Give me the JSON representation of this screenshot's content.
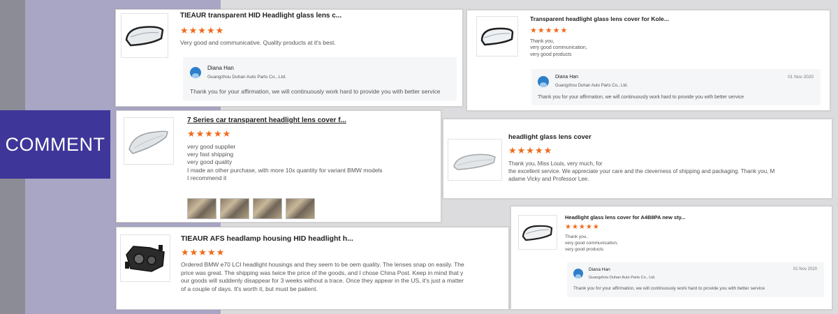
{
  "banner": {
    "label": "COMMENT"
  },
  "colors": {
    "accent_purple": "#3e3699",
    "star_orange": "#f06a1a",
    "avatar_blue": "#2d7fc9"
  },
  "reviews": [
    {
      "title": "TIEAUR transparent HID Headlight glass lens c...",
      "stars": "★★★★★",
      "rating": 5,
      "body": [
        "Very good and communicative. Quality products at it's best."
      ],
      "reply": {
        "name": "Diana Han",
        "company": "Guangzhou Duhan Auto Parts Co., Ltd.",
        "text": "Thank you for your affirmation, we will continuously work hard to provide you with better service"
      }
    },
    {
      "title": "Transparent headlight glass lens cover for Kole...",
      "stars": "★★★★★",
      "rating": 5,
      "body": [
        "Thank you,",
        "very good communication,",
        "very good products"
      ],
      "reply": {
        "name": "Diana Han",
        "company": "Guangzhou Duhan Auto Parts Co., Ltd.",
        "date": "01 Nov 2020",
        "text": "Thank you for your affirmation, we will continuously work hard to provide you with better service"
      }
    },
    {
      "title": "7 Series car transparent headlight lens cover f...",
      "stars": "★★★★★",
      "rating": 5,
      "body": [
        "very good supplier",
        "very fast shipping",
        "very good quality",
        "I made  an other purchase, with more 10x quantity  for variant   BMW models",
        "I recommend it"
      ]
    },
    {
      "title": "headlight glass lens cover",
      "stars": "★★★★★",
      "rating": 5,
      "body": [
        "Thank you, Miss Louis, very much, for",
        "the excellent service. We appreciate your care and the cleverness of shipping and packaging. Thank you, M",
        "adame Vicky and Professor Lee."
      ]
    },
    {
      "title": "Headlight glass lens cover for A4B8PA new sty...",
      "stars": "★★★★★",
      "rating": 5,
      "body": [
        "Thank you,",
        "very good communication,",
        "very good products"
      ],
      "reply": {
        "name": "Diana Han",
        "company": "Guangzhou Duhan Auto Parts Co., Ltd.",
        "date": "01 Nov 2020",
        "text": "Thank you for your affirmation, we will continuously work hard to provide you with better service"
      }
    },
    {
      "title": "TIEAUR AFS headlamp housing HID headlight h...",
      "stars": "★★★★★",
      "rating": 5,
      "body": [
        "Ordered BMW e70 LCI headlight housings and they seem to be oem quality. The lenses snap on easily. The",
        "price was great. The shipping was twice the price of the goods, and I chose China Post. Keep in mind that y",
        "our goods will suddenly disappear for 3 weeks without a trace. Once they appear in the US, it's just a matter",
        "of a couple of days. It's worth it, but must be patient."
      ]
    }
  ]
}
